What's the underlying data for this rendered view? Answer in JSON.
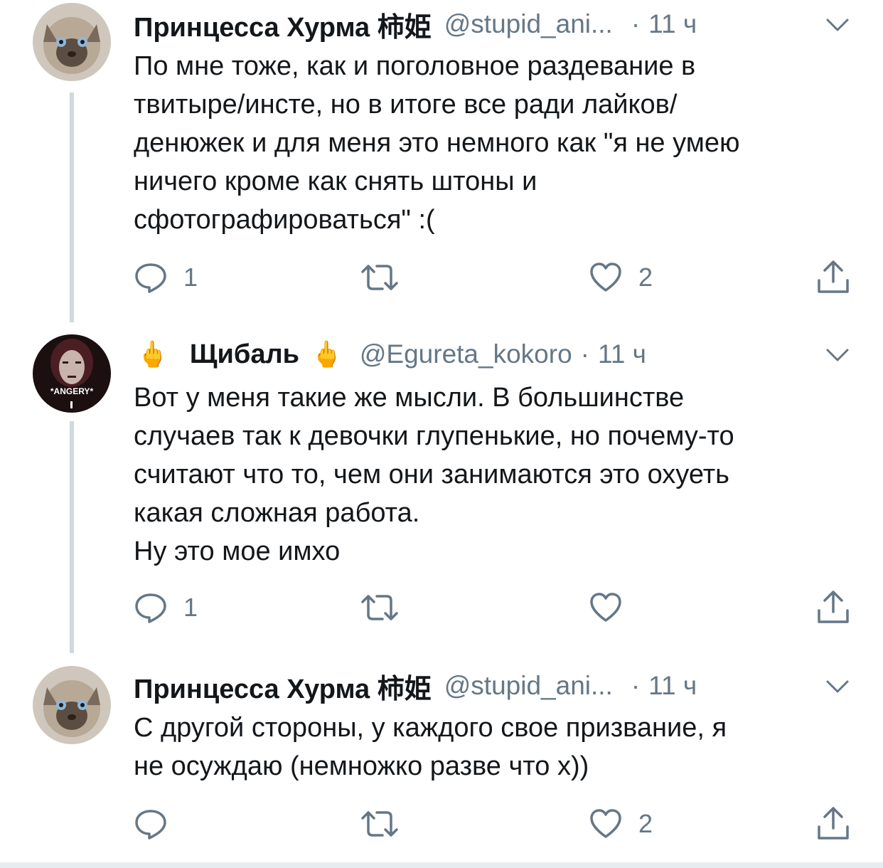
{
  "colors": {
    "text": "#14171a",
    "muted": "#657786",
    "connector": "#cfd9de"
  },
  "tweets": [
    {
      "name": "Принцесса Хурма 柿姫",
      "handle": "@stupid_ani...",
      "dot": "·",
      "time": "11 ч",
      "text": "По мне тоже, как и поголовное раздевание в\nтвитыре/инсте, но в итоге все ради лайков/\nденюжек и для меня это немного как \"я не умею\nничего кроме как снять штоны и\nсфотографироваться\" :(",
      "replies": "1",
      "retweets": "",
      "likes": "2"
    },
    {
      "name": "Щибаль",
      "name_emoji": "🖕",
      "handle": "@Egureta_kokoro",
      "dot": "·",
      "time": "11 ч",
      "avatar_caption": "*ANGERY*",
      "text": "Вот у меня такие же мысли. В большинстве\nслучаев так к девочки глупенькие, но почему-то\nсчитают что то, чем они занимаются это охуеть\nкакая сложная работа.\nНу это мое имхо",
      "replies": "1",
      "retweets": "",
      "likes": ""
    },
    {
      "name": "Принцесса Хурма 柿姫",
      "handle": "@stupid_ani...",
      "dot": "·",
      "time": "11 ч",
      "text": "С другой стороны, у каждого свое призвание, я\nне осуждаю (немножко разве что х))",
      "replies": "",
      "retweets": "",
      "likes": "2"
    }
  ],
  "icons": [
    "reply-icon",
    "retweet-icon",
    "like-icon",
    "share-icon",
    "chevron-down-icon"
  ]
}
